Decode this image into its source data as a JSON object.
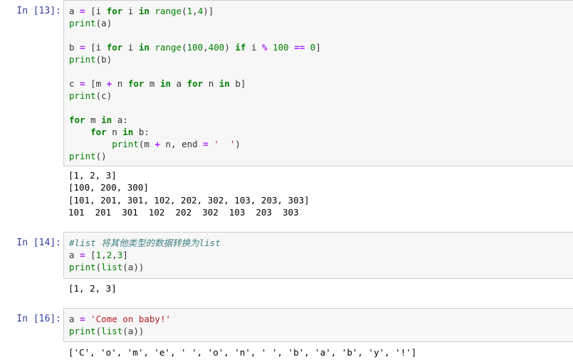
{
  "cells": [
    {
      "prompt": "In [13]:",
      "code": [
        [
          [
            "a ",
            ""
          ],
          [
            "=",
            "op"
          ],
          [
            " [i ",
            ""
          ],
          [
            "for",
            "kw"
          ],
          [
            " i ",
            ""
          ],
          [
            "in",
            "kw"
          ],
          [
            " ",
            ""
          ],
          [
            "range",
            "bi"
          ],
          [
            "(",
            ""
          ],
          [
            "1",
            "nm"
          ],
          [
            ",",
            ""
          ],
          [
            "4",
            "nm"
          ],
          [
            ")]",
            ""
          ]
        ],
        [
          [
            "print",
            "bi"
          ],
          [
            "(a)",
            ""
          ]
        ],
        [],
        [
          [
            "b ",
            ""
          ],
          [
            "=",
            "op"
          ],
          [
            " [i ",
            ""
          ],
          [
            "for",
            "kw"
          ],
          [
            " i ",
            ""
          ],
          [
            "in",
            "kw"
          ],
          [
            " ",
            ""
          ],
          [
            "range",
            "bi"
          ],
          [
            "(",
            ""
          ],
          [
            "100",
            "nm"
          ],
          [
            ",",
            ""
          ],
          [
            "400",
            "nm"
          ],
          [
            ") ",
            ""
          ],
          [
            "if",
            "kw"
          ],
          [
            " i ",
            ""
          ],
          [
            "%",
            "op"
          ],
          [
            " ",
            ""
          ],
          [
            "100",
            "nm"
          ],
          [
            " ",
            ""
          ],
          [
            "==",
            "op"
          ],
          [
            " ",
            ""
          ],
          [
            "0",
            "nm"
          ],
          [
            "]",
            ""
          ]
        ],
        [
          [
            "print",
            "bi"
          ],
          [
            "(b)",
            ""
          ]
        ],
        [],
        [
          [
            "c ",
            ""
          ],
          [
            "=",
            "op"
          ],
          [
            " [m ",
            ""
          ],
          [
            "+",
            "op"
          ],
          [
            " n ",
            ""
          ],
          [
            "for",
            "kw"
          ],
          [
            " m ",
            ""
          ],
          [
            "in",
            "kw"
          ],
          [
            " a ",
            ""
          ],
          [
            "for",
            "kw"
          ],
          [
            " n ",
            ""
          ],
          [
            "in",
            "kw"
          ],
          [
            " b]",
            ""
          ]
        ],
        [
          [
            "print",
            "bi"
          ],
          [
            "(c)",
            ""
          ]
        ],
        [],
        [
          [
            "for",
            "kw"
          ],
          [
            " m ",
            ""
          ],
          [
            "in",
            "kw"
          ],
          [
            " a:",
            ""
          ]
        ],
        [
          [
            "    ",
            ""
          ],
          [
            "for",
            "kw"
          ],
          [
            " n ",
            ""
          ],
          [
            "in",
            "kw"
          ],
          [
            " b:",
            ""
          ]
        ],
        [
          [
            "        ",
            ""
          ],
          [
            "print",
            "bi"
          ],
          [
            "(m ",
            ""
          ],
          [
            "+",
            "op"
          ],
          [
            " n, end ",
            ""
          ],
          [
            "=",
            "op"
          ],
          [
            " ",
            ""
          ],
          [
            "'  '",
            "st"
          ],
          [
            ")",
            ""
          ]
        ],
        [
          [
            "print",
            "bi"
          ],
          [
            "()",
            ""
          ]
        ]
      ],
      "output": [
        "[1, 2, 3]",
        "[100, 200, 300]",
        "[101, 201, 301, 102, 202, 302, 103, 203, 303]",
        "101  201  301  102  202  302  103  203  303  "
      ]
    },
    {
      "prompt": "In [14]:",
      "code": [
        [
          [
            "#list 将其他类型的数据转换为list",
            "cm"
          ]
        ],
        [
          [
            "a ",
            ""
          ],
          [
            "=",
            "op"
          ],
          [
            " [",
            ""
          ],
          [
            "1",
            "nm"
          ],
          [
            ",",
            ""
          ],
          [
            "2",
            "nm"
          ],
          [
            ",",
            ""
          ],
          [
            "3",
            "nm"
          ],
          [
            "]",
            ""
          ]
        ],
        [
          [
            "print",
            "bi"
          ],
          [
            "(",
            ""
          ],
          [
            "list",
            "bi"
          ],
          [
            "(a))",
            ""
          ]
        ]
      ],
      "output": [
        "[1, 2, 3]"
      ]
    },
    {
      "prompt": "In [16]:",
      "code": [
        [
          [
            "a ",
            ""
          ],
          [
            "=",
            "op"
          ],
          [
            " ",
            ""
          ],
          [
            "'Come on baby!'",
            "st"
          ]
        ],
        [
          [
            "print",
            "bi"
          ],
          [
            "(",
            ""
          ],
          [
            "list",
            "bi"
          ],
          [
            "(a))",
            ""
          ]
        ]
      ],
      "output": [
        "['C', 'o', 'm', 'e', ' ', 'o', 'n', ' ', 'b', 'a', 'b', 'y', '!']"
      ]
    }
  ]
}
